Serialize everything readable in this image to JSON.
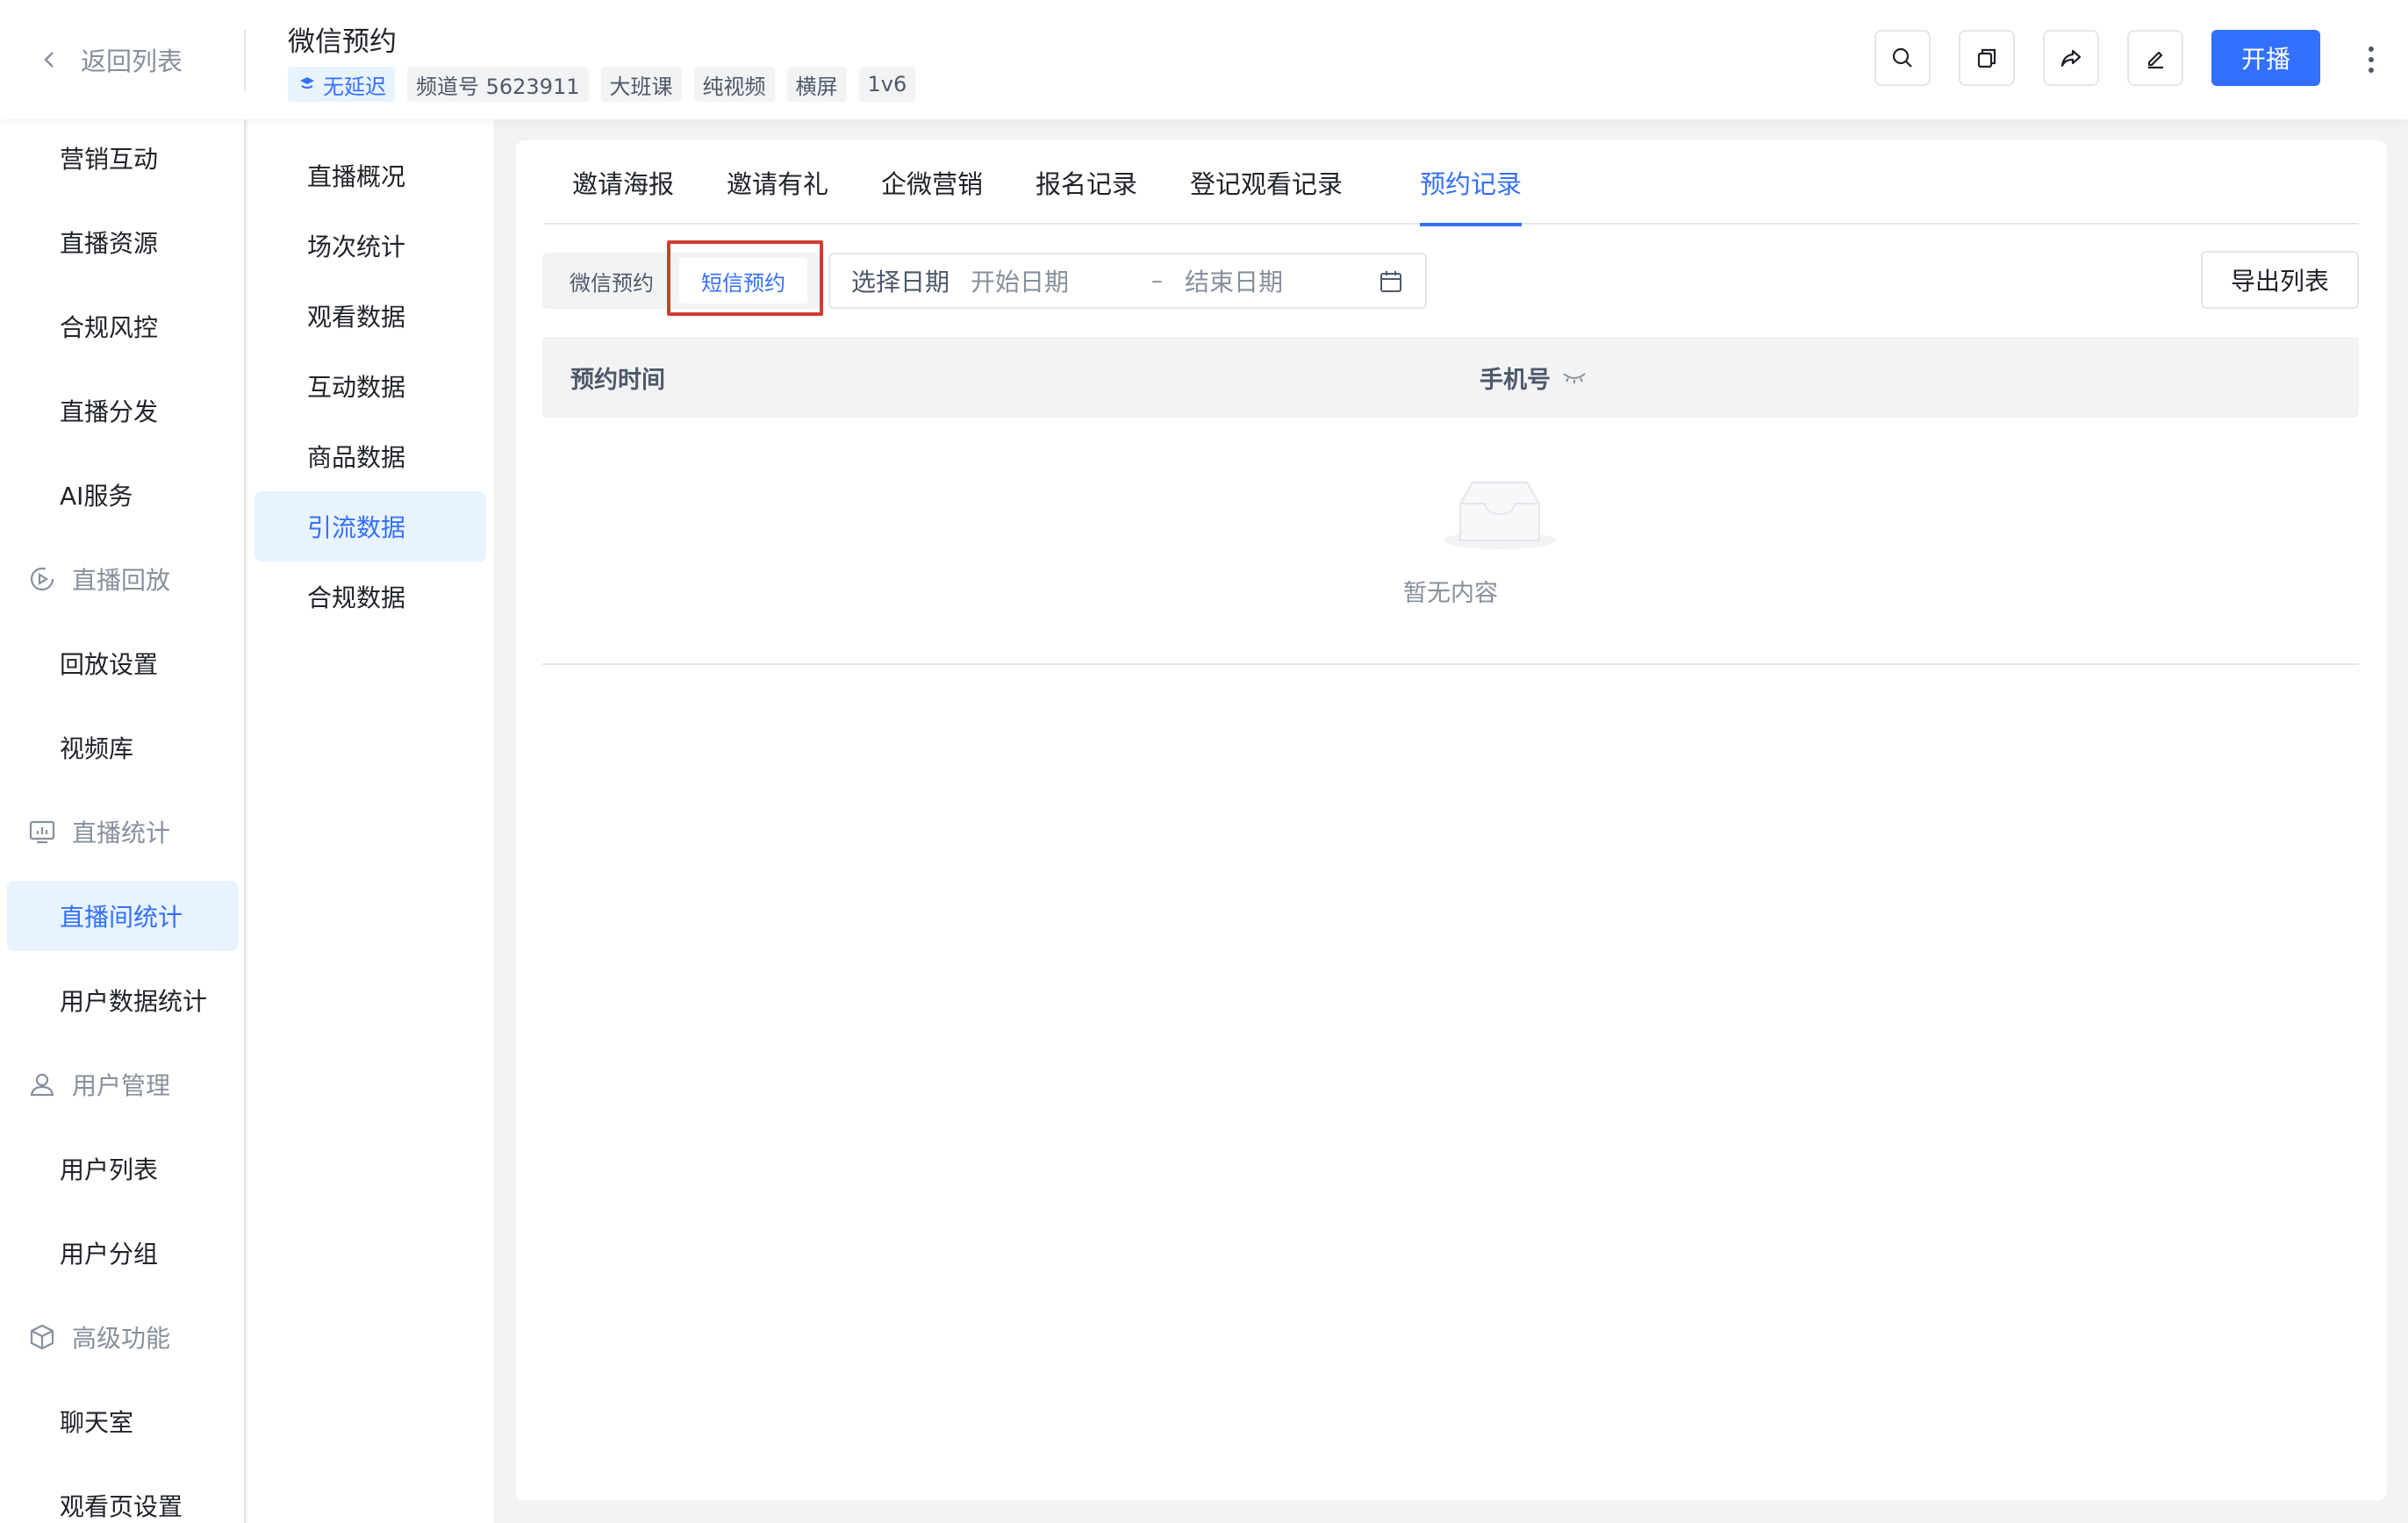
{
  "header": {
    "back_label": "返回列表",
    "title": "微信预约",
    "tags": [
      "无延迟",
      "频道号 5623911",
      "大班课",
      "纯视频",
      "横屏",
      "1v6"
    ],
    "live_label": "开播"
  },
  "sidebar": {
    "items": [
      "营销互动",
      "直播资源",
      "合规风控",
      "直播分发",
      "AI服务"
    ],
    "group_replay": "直播回放",
    "replay_items": [
      "回放设置",
      "视频库"
    ],
    "group_stats": "直播统计",
    "stats_items": [
      "直播间统计",
      "用户数据统计"
    ],
    "group_users": "用户管理",
    "user_items": [
      "用户列表",
      "用户分组"
    ],
    "group_advanced": "高级功能",
    "advanced_items": [
      "聊天室",
      "观看页设置"
    ]
  },
  "subnav": {
    "items": [
      "直播概况",
      "场次统计",
      "观看数据",
      "互动数据",
      "商品数据",
      "引流数据",
      "合规数据"
    ]
  },
  "tabs": [
    "邀请海报",
    "邀请有礼",
    "企微营销",
    "报名记录",
    "登记观看记录",
    "预约记录"
  ],
  "filter": {
    "seg_wechat": "微信预约",
    "seg_sms": "短信预约",
    "date_label": "选择日期",
    "start_placeholder": "开始日期",
    "separator": "–",
    "end_placeholder": "结束日期",
    "export_label": "导出列表"
  },
  "table": {
    "columns": [
      "预约时间",
      "手机号"
    ],
    "empty_text": "暂无内容"
  },
  "colors": {
    "accent": "#3370ff",
    "highlight": "#d23c2f"
  }
}
